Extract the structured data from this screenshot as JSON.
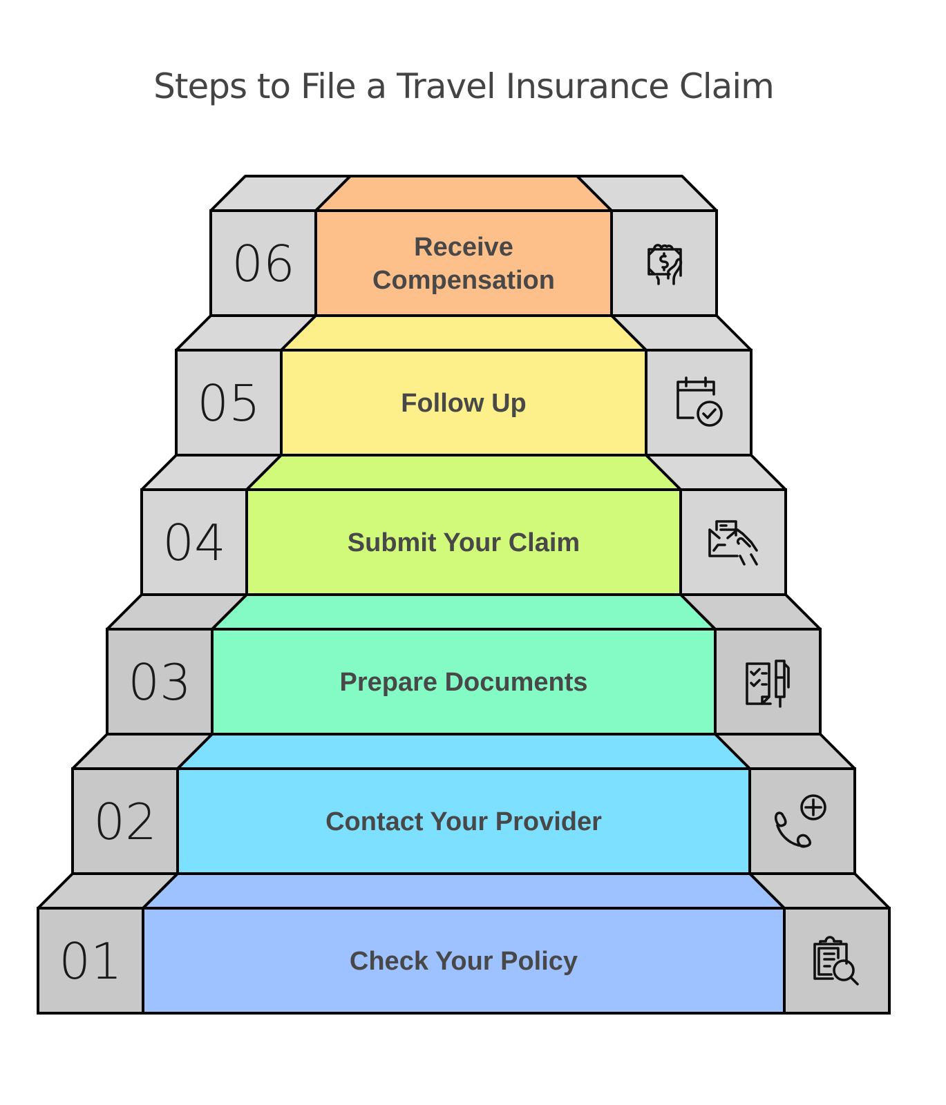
{
  "title": "Steps to File a Travel Insurance Claim",
  "steps": [
    {
      "number": "01",
      "label": [
        "Check Your Policy"
      ],
      "icon": "clipboard-search-icon",
      "color": "#9dc2ff"
    },
    {
      "number": "02",
      "label": [
        "Contact Your Provider"
      ],
      "icon": "phone-plus-icon",
      "color": "#7ee0ff"
    },
    {
      "number": "03",
      "label": [
        "Prepare Documents"
      ],
      "icon": "checklist-pen-icon",
      "color": "#84fbc4"
    },
    {
      "number": "04",
      "label": [
        "Submit Your Claim"
      ],
      "icon": "envelope-hand-icon",
      "color": "#d2fa7a"
    },
    {
      "number": "05",
      "label": [
        "Follow Up"
      ],
      "icon": "calendar-check-icon",
      "color": "#fdf08a"
    },
    {
      "number": "06",
      "label": [
        "Receive",
        "Compensation"
      ],
      "icon": "money-hand-icon",
      "color": "#fdc08a"
    }
  ],
  "colors": {
    "side_gray": "#c8c8c8",
    "side_gray_top": "#d9d9d9",
    "outline": "#000000",
    "label_text": "#484848"
  }
}
